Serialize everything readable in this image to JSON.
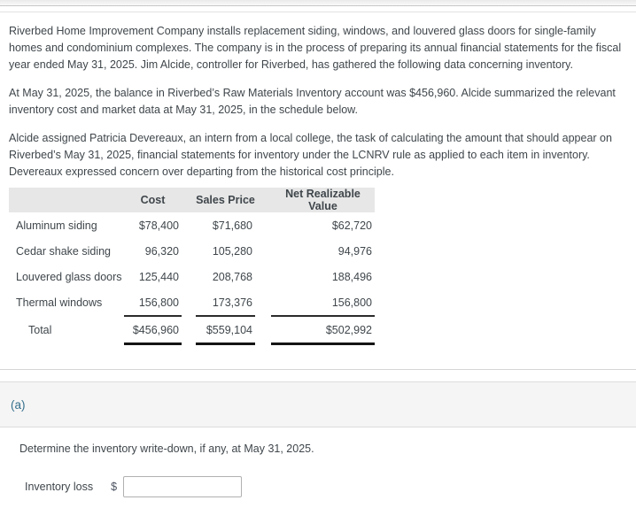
{
  "colors": {
    "accent_teal": "#35708c",
    "table_header_bg": "#e7e7e7",
    "band_bg": "#f5f5f5",
    "text": "#3f464b"
  },
  "problem": {
    "paragraphs": [
      "Riverbed Home Improvement Company installs replacement siding, windows, and louvered glass doors for single-family homes and condominium complexes. The company is in the process of preparing its annual financial statements for the fiscal year ended May 31, 2025. Jim Alcide, controller for Riverbed, has gathered the following data concerning inventory.",
      "At May 31, 2025, the balance in Riverbed’s Raw Materials Inventory account was $456,960. Alcide summarized the relevant inventory cost and market data at May 31, 2025, in the schedule below.",
      "Alcide assigned Patricia Devereaux, an intern from a local college, the task of calculating the amount that should appear on Riverbed’s May 31, 2025, financial statements for inventory under the LCNRV rule as applied to each item in inventory. Devereaux expressed concern over departing from the historical cost principle."
    ]
  },
  "table": {
    "headers": {
      "item": "",
      "cost": "Cost",
      "sales_price": "Sales Price",
      "nrv": "Net Realizable Value"
    },
    "rows": [
      {
        "name": "Aluminum siding",
        "cost": "$78,400",
        "sales": "$71,680",
        "nrv": "$62,720"
      },
      {
        "name": "Cedar shake siding",
        "cost": "96,320",
        "sales": "105,280",
        "nrv": "94,976"
      },
      {
        "name": "Louvered glass doors",
        "cost": "125,440",
        "sales": "208,768",
        "nrv": "188,496"
      },
      {
        "name": "Thermal windows",
        "cost": "156,800",
        "sales": "173,376",
        "nrv": "156,800"
      }
    ],
    "total": {
      "name": "Total",
      "cost": "$456,960",
      "sales": "$559,104",
      "nrv": "$502,992"
    }
  },
  "section": {
    "label": "(a)",
    "instruction": "Determine the inventory write-down, if any, at May 31, 2025.",
    "answer": {
      "label": "Inventory loss",
      "currency": "$",
      "value": ""
    }
  }
}
